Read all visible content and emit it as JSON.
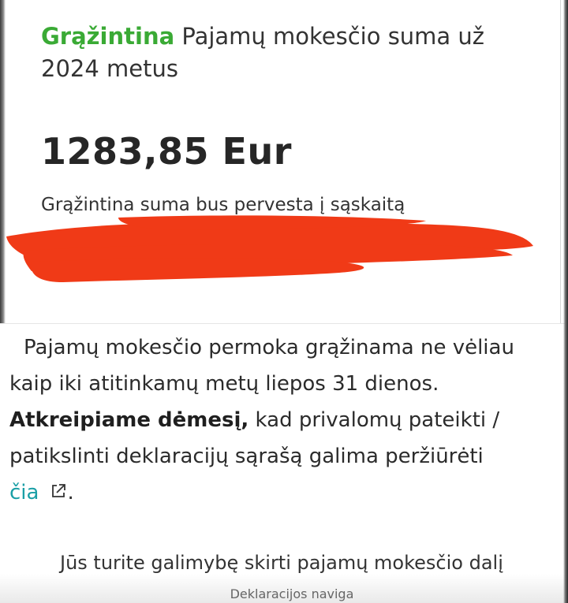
{
  "header": {
    "status": "Grąžintina",
    "title_rest": "Pajamų mokesčio suma už 2024 metus"
  },
  "amount": "1283,85 Eur",
  "transfer_note": "Grąžintina suma bus pervesta į sąskaitą",
  "redaction_color": "#f03a17",
  "info": {
    "line1": "Pajamų mokesčio permoka grąžinama ne vėliau kaip iki atitinkamų metų liepos 31 dienos.",
    "bold": "Atkreipiame dėmesį,",
    "line2": " kad privalomų pateikti / patikslinti deklaracijų sąrašą galima peržiūrėti",
    "link": "čia",
    "after_link": "."
  },
  "more_text": "Jūs turite galimybę skirti pajamų mokesčio dalį",
  "nav_pill": "Deklaracijos naviga"
}
